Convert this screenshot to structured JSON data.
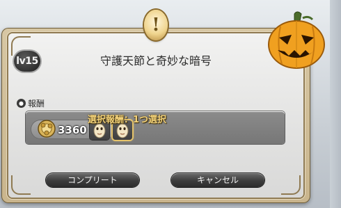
{
  "dialog": {
    "level": "lv15",
    "title": "守護天節と奇妙な暗号",
    "reward_label": "報酬",
    "reward_choose": "選択報酬：1つ選択",
    "gil_amount": "3360",
    "buttons": {
      "complete": "コンプリート",
      "cancel": "キャンセル"
    }
  },
  "icons": {
    "badge": "quest-exclamation-icon",
    "pumpkin": "jack-o-lantern-icon",
    "gil": "gil-coin-icon",
    "reward": "reward-icon",
    "item1": "mask-item-icon",
    "item2": "mask-item-icon"
  },
  "colors": {
    "frame": "#c9b58d",
    "gold_text": "#f3d27a",
    "pumpkin": "#f0a020"
  }
}
